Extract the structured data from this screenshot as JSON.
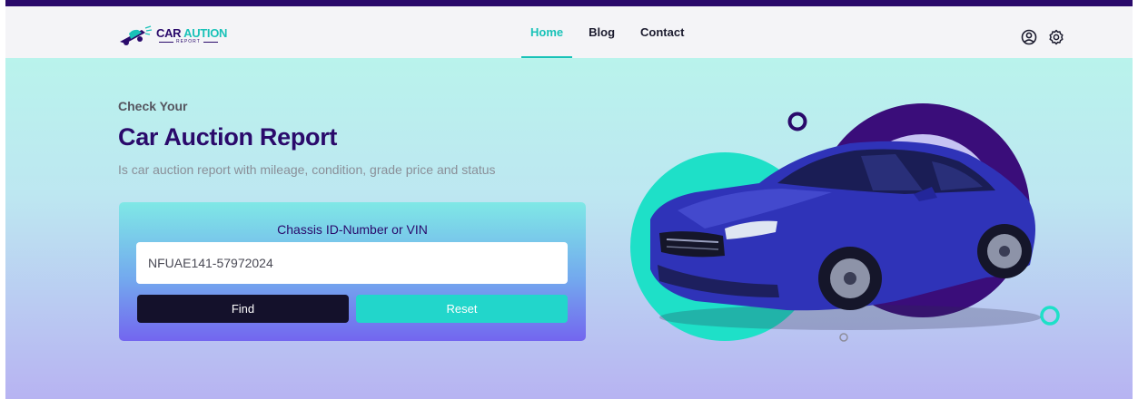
{
  "brand": {
    "name_primary": "CAR",
    "name_accent": "AUTION",
    "tagline": "REPORT"
  },
  "nav": {
    "items": [
      {
        "label": "Home",
        "active": true
      },
      {
        "label": "Blog",
        "active": false
      },
      {
        "label": "Contact",
        "active": false
      }
    ]
  },
  "header_icons": [
    "user-circle-icon",
    "gear-icon"
  ],
  "hero": {
    "eyebrow": "Check Your",
    "title": "Car Auction Report",
    "subtitle": "Is car auction report with mileage, condition, grade price and status"
  },
  "search": {
    "label": "Chassis ID-Number or VIN",
    "value": "NFUAE141-57972024",
    "find_label": "Find",
    "reset_label": "Reset"
  },
  "colors": {
    "brand_purple": "#2a0a6b",
    "accent_teal": "#19c2b8",
    "find_button": "#14112b",
    "reset_button": "#22d6cb"
  }
}
